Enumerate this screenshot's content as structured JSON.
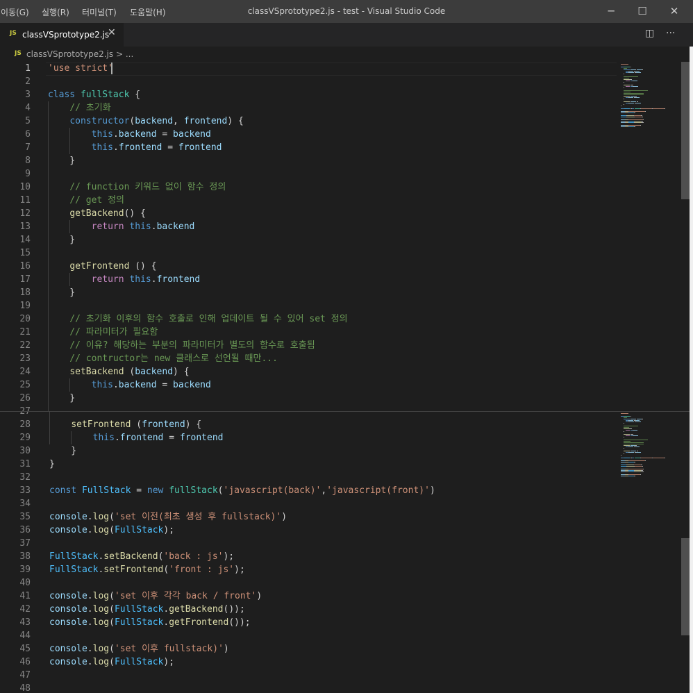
{
  "window": {
    "menus": [
      "이동(G)",
      "실행(R)",
      "터미널(T)",
      "도움말(H)"
    ],
    "title": "classVSprototype2.js - test - Visual Studio Code",
    "controls": {
      "minimize": "─",
      "maximize": "☐",
      "close": "✕"
    }
  },
  "editor": {
    "tab": {
      "icon": "JS",
      "label": "classVSprototype2.js",
      "close": "✕"
    },
    "actions": {
      "split": "◫",
      "more": "···"
    },
    "breadcrumb": {
      "icon": "JS",
      "file": "classVSprototype2.js",
      "separator": ">",
      "more": "..."
    }
  },
  "colors": {
    "keyword": "#569cd6",
    "control": "#c586c0",
    "string": "#ce9178",
    "comment": "#6a9955",
    "function": "#dcdcaa",
    "class": "#4ec9b0",
    "variable": "#9cdcfe",
    "constant": "#4fc1ff",
    "plain": "#d4d4d4"
  },
  "code": [
    {
      "n": "1",
      "t": [
        [
          "str",
          "'use strict'"
        ]
      ]
    },
    {
      "n": "2",
      "t": []
    },
    {
      "n": "3",
      "t": [
        [
          "kw",
          "class"
        ],
        [
          "pl",
          " "
        ],
        [
          "cls",
          "fullStack"
        ],
        [
          "pl",
          " {"
        ]
      ]
    },
    {
      "n": "4",
      "t": [
        [
          "cmt",
          "    // 초기화"
        ]
      ]
    },
    {
      "n": "5",
      "t": [
        [
          "pl",
          "    "
        ],
        [
          "kw",
          "constructor"
        ],
        [
          "pl",
          "("
        ],
        [
          "var",
          "backend"
        ],
        [
          "pl",
          ", "
        ],
        [
          "var",
          "frontend"
        ],
        [
          "pl",
          ") {"
        ]
      ]
    },
    {
      "n": "6",
      "t": [
        [
          "pl",
          "        "
        ],
        [
          "kw",
          "this"
        ],
        [
          "pl",
          "."
        ],
        [
          "var",
          "backend"
        ],
        [
          "pl",
          " = "
        ],
        [
          "var",
          "backend"
        ]
      ]
    },
    {
      "n": "7",
      "t": [
        [
          "pl",
          "        "
        ],
        [
          "kw",
          "this"
        ],
        [
          "pl",
          "."
        ],
        [
          "var",
          "frontend"
        ],
        [
          "pl",
          " = "
        ],
        [
          "var",
          "frontend"
        ]
      ]
    },
    {
      "n": "8",
      "t": [
        [
          "pl",
          "    }"
        ]
      ]
    },
    {
      "n": "9",
      "t": []
    },
    {
      "n": "10",
      "t": [
        [
          "cmt",
          "    // function 키워드 없이 함수 정의"
        ]
      ]
    },
    {
      "n": "11",
      "t": [
        [
          "cmt",
          "    // get 정의"
        ]
      ]
    },
    {
      "n": "12",
      "t": [
        [
          "pl",
          "    "
        ],
        [
          "fn",
          "getBackend"
        ],
        [
          "pl",
          "() {"
        ]
      ]
    },
    {
      "n": "13",
      "t": [
        [
          "pl",
          "        "
        ],
        [
          "ctl",
          "return"
        ],
        [
          "pl",
          " "
        ],
        [
          "kw",
          "this"
        ],
        [
          "pl",
          "."
        ],
        [
          "var",
          "backend"
        ]
      ]
    },
    {
      "n": "14",
      "t": [
        [
          "pl",
          "    }"
        ]
      ]
    },
    {
      "n": "15",
      "t": []
    },
    {
      "n": "16",
      "t": [
        [
          "pl",
          "    "
        ],
        [
          "fn",
          "getFrontend"
        ],
        [
          "pl",
          " () {"
        ]
      ]
    },
    {
      "n": "17",
      "t": [
        [
          "pl",
          "        "
        ],
        [
          "ctl",
          "return"
        ],
        [
          "pl",
          " "
        ],
        [
          "kw",
          "this"
        ],
        [
          "pl",
          "."
        ],
        [
          "var",
          "frontend"
        ]
      ]
    },
    {
      "n": "18",
      "t": [
        [
          "pl",
          "    }"
        ]
      ]
    },
    {
      "n": "19",
      "t": []
    },
    {
      "n": "20",
      "t": [
        [
          "cmt",
          "    // 초기화 이후의 함수 호출로 인해 업데이트 될 수 있어 set 정의"
        ]
      ]
    },
    {
      "n": "21",
      "t": [
        [
          "cmt",
          "    // 파라미터가 필요함"
        ]
      ]
    },
    {
      "n": "22",
      "t": [
        [
          "cmt",
          "    // 이유? 해당하는 부분의 파라미터가 별도의 함수로 호출됨"
        ]
      ]
    },
    {
      "n": "23",
      "t": [
        [
          "cmt",
          "    // contructor는 new 클래스로 선언될 때만..."
        ]
      ]
    },
    {
      "n": "24",
      "t": [
        [
          "pl",
          "    "
        ],
        [
          "fn",
          "setBackend"
        ],
        [
          "pl",
          " ("
        ],
        [
          "var",
          "backend"
        ],
        [
          "pl",
          ") {"
        ]
      ]
    },
    {
      "n": "25",
      "t": [
        [
          "pl",
          "        "
        ],
        [
          "kw",
          "this"
        ],
        [
          "pl",
          "."
        ],
        [
          "var",
          "backend"
        ],
        [
          "pl",
          " = "
        ],
        [
          "var",
          "backend"
        ]
      ]
    },
    {
      "n": "26",
      "t": [
        [
          "pl",
          "    }"
        ]
      ]
    },
    {
      "n": "27",
      "t": []
    },
    {
      "n": "28",
      "t": [
        [
          "pl",
          "    "
        ],
        [
          "fn",
          "setFrontend"
        ],
        [
          "pl",
          " ("
        ],
        [
          "var",
          "frontend"
        ],
        [
          "pl",
          ") {"
        ]
      ]
    },
    {
      "n": "29",
      "t": [
        [
          "pl",
          "        "
        ],
        [
          "kw",
          "this"
        ],
        [
          "pl",
          "."
        ],
        [
          "var",
          "frontend"
        ],
        [
          "pl",
          " = "
        ],
        [
          "var",
          "frontend"
        ]
      ]
    },
    {
      "n": "30",
      "t": [
        [
          "pl",
          "    }"
        ]
      ]
    },
    {
      "n": "31",
      "t": [
        [
          "pl",
          "}"
        ]
      ]
    },
    {
      "n": "32",
      "t": []
    },
    {
      "n": "33",
      "t": [
        [
          "kw",
          "const"
        ],
        [
          "pl",
          " "
        ],
        [
          "const",
          "FullStack"
        ],
        [
          "pl",
          " = "
        ],
        [
          "kw",
          "new"
        ],
        [
          "pl",
          " "
        ],
        [
          "cls",
          "fullStack"
        ],
        [
          "pl",
          "("
        ],
        [
          "str",
          "'javascript(back)'"
        ],
        [
          "pl",
          ","
        ],
        [
          "str",
          "'javascript(front)'"
        ],
        [
          "pl",
          ")"
        ]
      ]
    },
    {
      "n": "34",
      "t": []
    },
    {
      "n": "35",
      "t": [
        [
          "var",
          "console"
        ],
        [
          "pl",
          "."
        ],
        [
          "fn",
          "log"
        ],
        [
          "pl",
          "("
        ],
        [
          "str",
          "'set 이전(최초 생성 후 fullstack)'"
        ],
        [
          "pl",
          ")"
        ]
      ]
    },
    {
      "n": "36",
      "t": [
        [
          "var",
          "console"
        ],
        [
          "pl",
          "."
        ],
        [
          "fn",
          "log"
        ],
        [
          "pl",
          "("
        ],
        [
          "const",
          "FullStack"
        ],
        [
          "pl",
          ");"
        ]
      ]
    },
    {
      "n": "37",
      "t": []
    },
    {
      "n": "38",
      "t": [
        [
          "const",
          "FullStack"
        ],
        [
          "pl",
          "."
        ],
        [
          "fn",
          "setBackend"
        ],
        [
          "pl",
          "("
        ],
        [
          "str",
          "'back : js'"
        ],
        [
          "pl",
          ");"
        ]
      ]
    },
    {
      "n": "39",
      "t": [
        [
          "const",
          "FullStack"
        ],
        [
          "pl",
          "."
        ],
        [
          "fn",
          "setFrontend"
        ],
        [
          "pl",
          "("
        ],
        [
          "str",
          "'front : js'"
        ],
        [
          "pl",
          ");"
        ]
      ]
    },
    {
      "n": "40",
      "t": []
    },
    {
      "n": "41",
      "t": [
        [
          "var",
          "console"
        ],
        [
          "pl",
          "."
        ],
        [
          "fn",
          "log"
        ],
        [
          "pl",
          "("
        ],
        [
          "str",
          "'set 이후 각각 back / front'"
        ],
        [
          "pl",
          ")"
        ]
      ]
    },
    {
      "n": "42",
      "t": [
        [
          "var",
          "console"
        ],
        [
          "pl",
          "."
        ],
        [
          "fn",
          "log"
        ],
        [
          "pl",
          "("
        ],
        [
          "const",
          "FullStack"
        ],
        [
          "pl",
          "."
        ],
        [
          "fn",
          "getBackend"
        ],
        [
          "pl",
          "());"
        ]
      ]
    },
    {
      "n": "43",
      "t": [
        [
          "var",
          "console"
        ],
        [
          "pl",
          "."
        ],
        [
          "fn",
          "log"
        ],
        [
          "pl",
          "("
        ],
        [
          "const",
          "FullStack"
        ],
        [
          "pl",
          "."
        ],
        [
          "fn",
          "getFrontend"
        ],
        [
          "pl",
          "());"
        ]
      ]
    },
    {
      "n": "44",
      "t": []
    },
    {
      "n": "45",
      "t": [
        [
          "var",
          "console"
        ],
        [
          "pl",
          "."
        ],
        [
          "fn",
          "log"
        ],
        [
          "pl",
          "("
        ],
        [
          "str",
          "'set 이후 fullstack)'"
        ],
        [
          "pl",
          ")"
        ]
      ]
    },
    {
      "n": "46",
      "t": [
        [
          "var",
          "console"
        ],
        [
          "pl",
          "."
        ],
        [
          "fn",
          "log"
        ],
        [
          "pl",
          "("
        ],
        [
          "const",
          "FullStack"
        ],
        [
          "pl",
          ");"
        ]
      ]
    },
    {
      "n": "47",
      "t": []
    },
    {
      "n": "48",
      "t": []
    }
  ]
}
